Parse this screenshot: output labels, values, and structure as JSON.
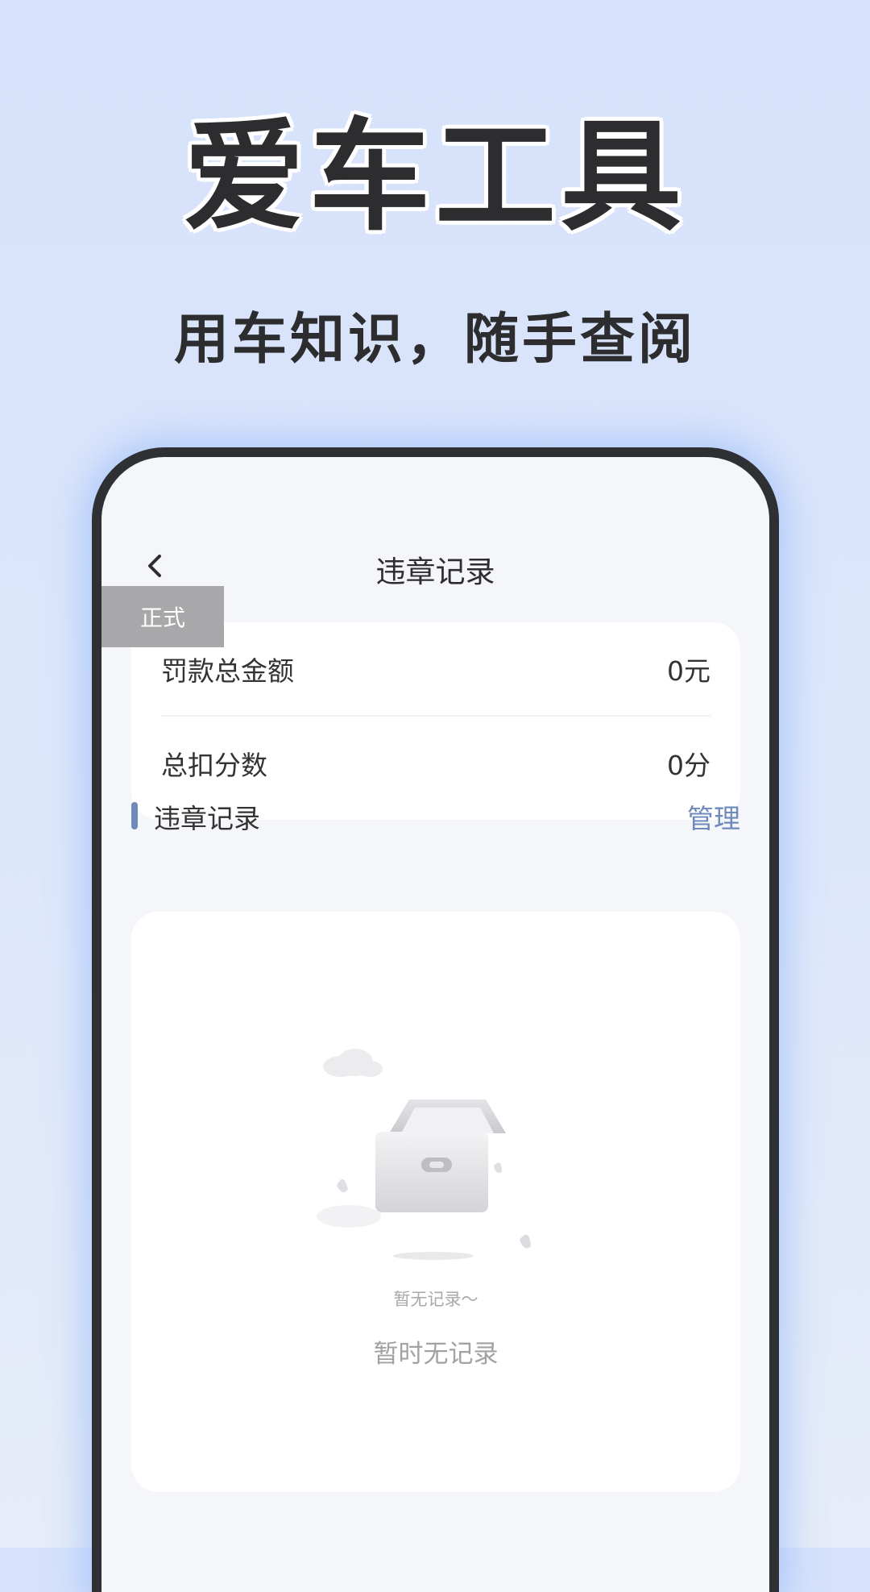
{
  "hero": {
    "title": "爱车工具",
    "subtitle": "用车知识，随手查阅"
  },
  "nav": {
    "title": "违章记录",
    "back_icon": "chevron-left-icon"
  },
  "env_badge": "正式",
  "summary": {
    "rows": [
      {
        "label": "罚款总金额",
        "value": "0元"
      },
      {
        "label": "总扣分数",
        "value": "0分"
      }
    ]
  },
  "records": {
    "section_title": "违章记录",
    "manage_label": "管理",
    "empty_illustration": "empty-box-icon",
    "empty_small": "暂无记录～",
    "empty_text": "暂时无记录"
  },
  "colors": {
    "accent": "#6f89bb",
    "background": "#d6e2fb",
    "phone_frame": "#2f3033"
  }
}
